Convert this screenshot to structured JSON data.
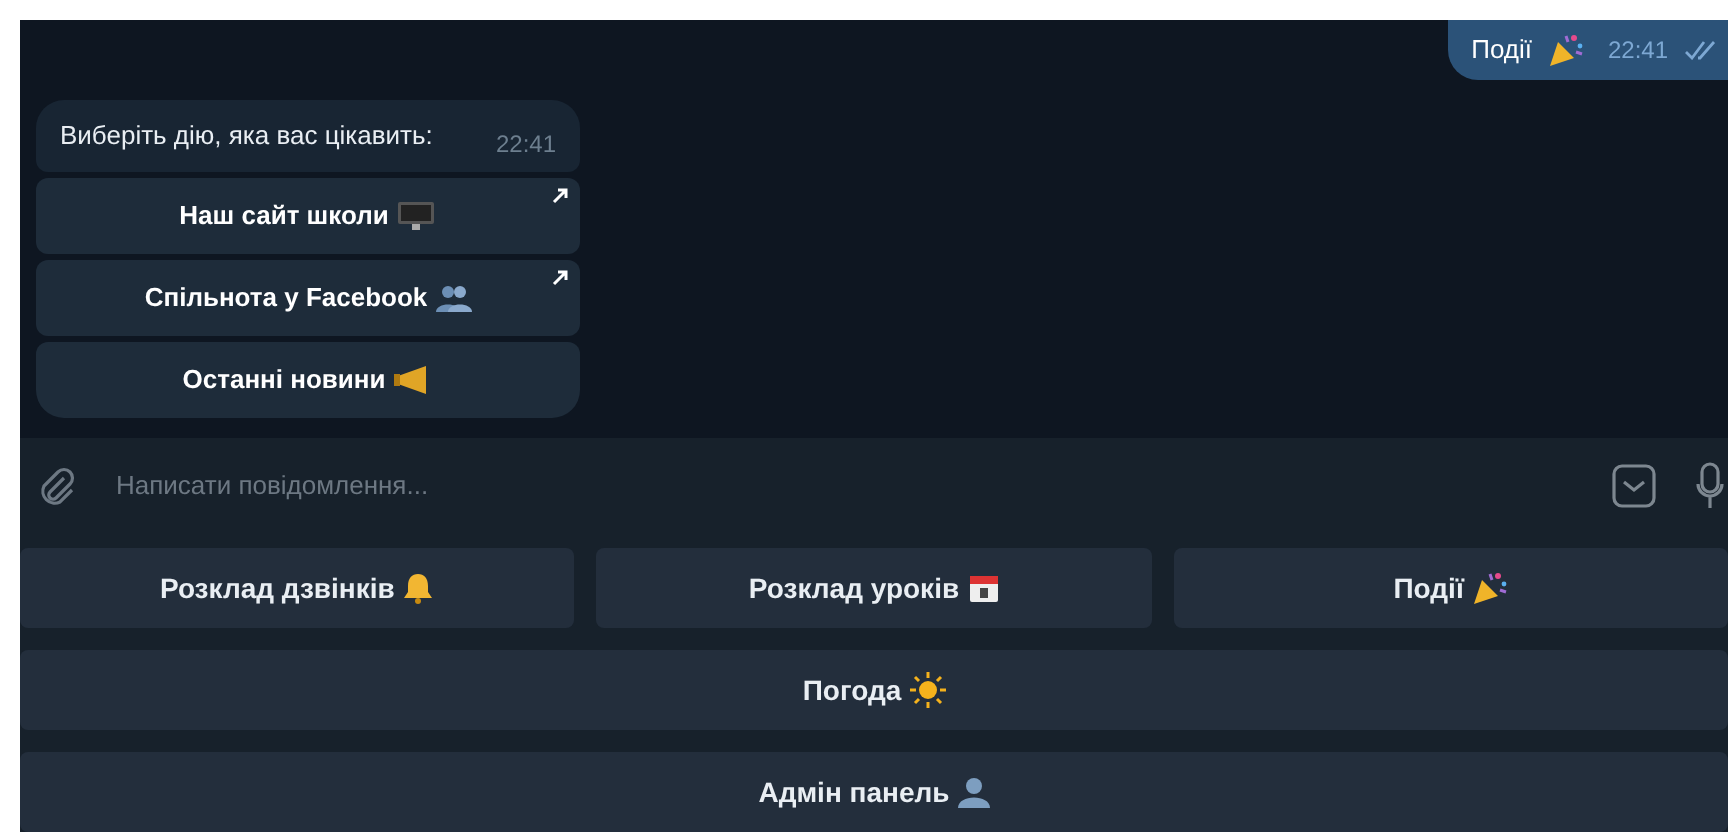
{
  "outgoing_message": {
    "text": "Події",
    "time": "22:41",
    "read": true
  },
  "incoming_message": {
    "text": "Виберіть дію, яка вас цікавить:",
    "time": "22:41"
  },
  "inline_buttons": [
    {
      "label": "Наш сайт школи",
      "link": true
    },
    {
      "label": "Спільнота у Facebook",
      "link": true
    },
    {
      "label": "Останні новини",
      "link": false
    }
  ],
  "composer": {
    "placeholder": "Написати повідомлення..."
  },
  "keyboard_rows": [
    [
      "Розклад дзвінків",
      "Розклад уроків",
      "Події"
    ],
    [
      "Погода"
    ],
    [
      "Адмін панель"
    ]
  ]
}
